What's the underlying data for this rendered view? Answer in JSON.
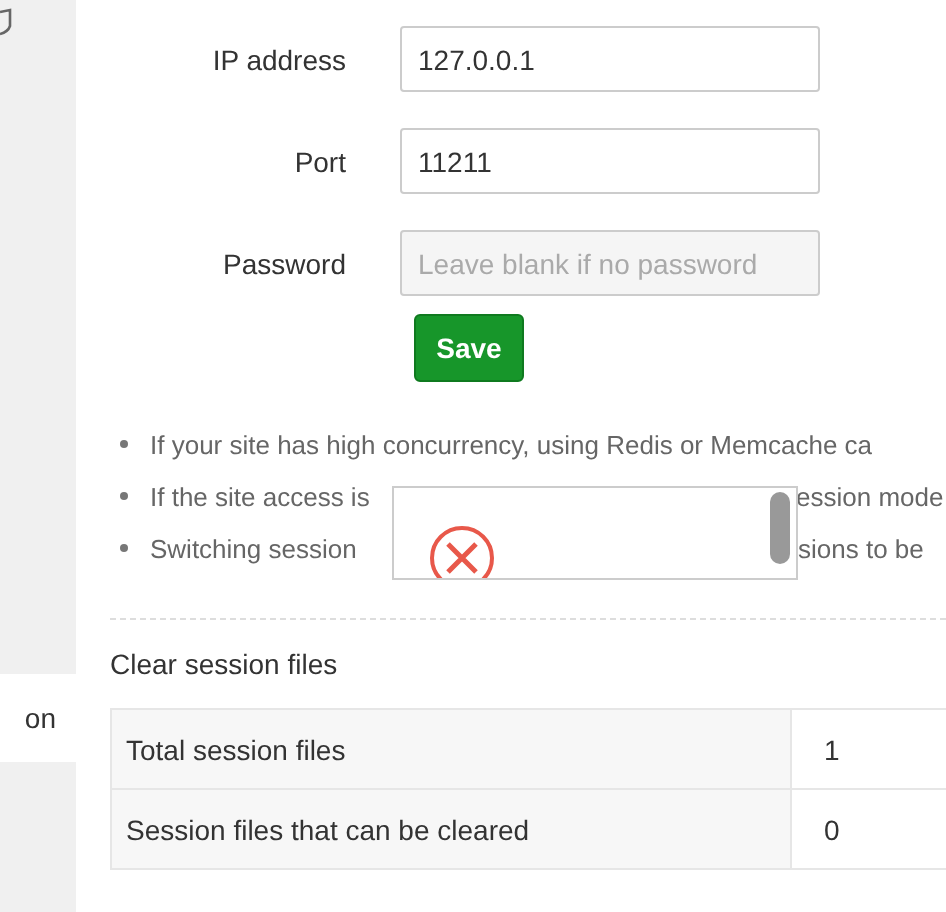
{
  "sidebar": {
    "items": [
      {
        "label": "on",
        "selected": true
      }
    ]
  },
  "form": {
    "fields": [
      {
        "label": "IP address",
        "value": "127.0.0.1"
      },
      {
        "label": "Port",
        "value": "11211"
      },
      {
        "label": "Password",
        "placeholder": "Leave blank if no password"
      }
    ],
    "save_button": "Save"
  },
  "notes": [
    {
      "before": "If your site has high concurrency, using Redis or Memcache ca"
    },
    {
      "before": "If the site access is",
      "after": "ession mode"
    },
    {
      "before": "Switching session",
      "after": "sions to be"
    }
  ],
  "popup": {
    "kind": "error"
  },
  "clear_section": {
    "title": "Clear session files",
    "rows": [
      {
        "label": "Total session files",
        "value": "1"
      },
      {
        "label": "Session files that can be cleared",
        "value": "0"
      }
    ]
  }
}
